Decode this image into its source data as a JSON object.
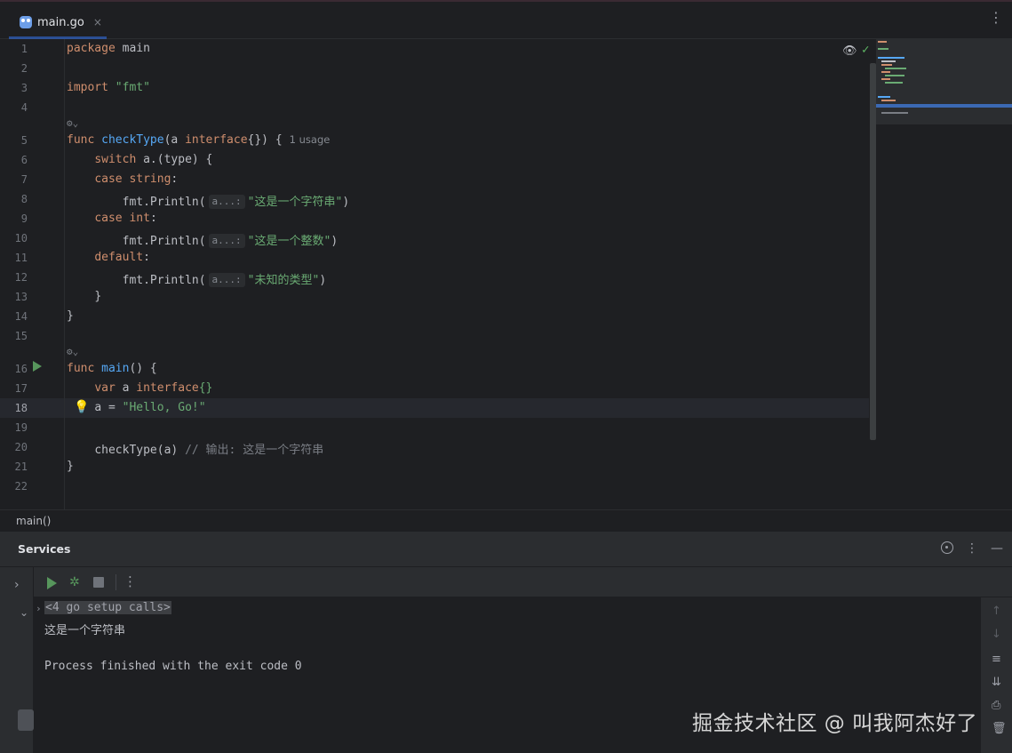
{
  "tab": {
    "filename": "main.go",
    "close": "×",
    "file_icon": "go-gopher-icon"
  },
  "editor_menu": "⋮",
  "lines": [
    {
      "n": "1"
    },
    {
      "n": "2"
    },
    {
      "n": "3"
    },
    {
      "n": "4"
    },
    {
      "n": "5"
    },
    {
      "n": "6"
    },
    {
      "n": "7"
    },
    {
      "n": "8"
    },
    {
      "n": "9"
    },
    {
      "n": "10"
    },
    {
      "n": "11"
    },
    {
      "n": "12"
    },
    {
      "n": "13"
    },
    {
      "n": "14"
    },
    {
      "n": "15"
    },
    {
      "n": "16"
    },
    {
      "n": "17"
    },
    {
      "n": "18"
    },
    {
      "n": "19"
    },
    {
      "n": "20"
    },
    {
      "n": "21"
    },
    {
      "n": "22"
    }
  ],
  "code": {
    "l1_kw": "package",
    "l1_name": " main",
    "l3_kw": "import",
    "l3_str": " \"fmt\"",
    "l5_kw": "func",
    "l5_fn": " checkType",
    "l5_p1": "(a ",
    "l5_iface": "interface",
    "l5_p2": "{}) {",
    "l5_usage": "1 usage",
    "l6_kw": "switch",
    "l6_rest": " a.(type) {",
    "l7_kw": "case",
    "l7_type": " string",
    "l7_colon": ":",
    "l8_call": "fmt.Println(",
    "l8_hint": "a...:",
    "l8_str": "\"这是一个字符串\"",
    "l8_end": ")",
    "l9_kw": "case",
    "l9_type": " int",
    "l9_colon": ":",
    "l10_call": "fmt.Println(",
    "l10_hint": "a...:",
    "l10_str": "\"这是一个整数\"",
    "l10_end": ")",
    "l11_kw": "default",
    "l11_colon": ":",
    "l12_call": "fmt.Println(",
    "l12_hint": "a...:",
    "l12_str": "\"未知的类型\"",
    "l12_end": ")",
    "l13": "}",
    "l14": "}",
    "l16_kw": "func",
    "l16_fn": " main",
    "l16_rest": "() {",
    "l17_kw": "var",
    "l17_name": " a ",
    "l17_iface": "interface",
    "l17_end": "{}",
    "l18_lhs": "a = ",
    "l18_str": "\"Hello, Go!\"",
    "l20_call": "checkType(a) ",
    "l20_cmt": "// 输出: 这是一个字符串",
    "l21": "}"
  },
  "breadcrumb": "main()",
  "services": {
    "title": "Services",
    "console": {
      "setup": "<4 go setup calls>",
      "output": "这是一个字符串",
      "exit": "Process finished with the exit code 0"
    }
  },
  "watermark": "掘金技术社区 @ 叫我阿杰好了",
  "colors": {
    "keyword": "#cf8e6d",
    "function": "#56a8f5",
    "string": "#6aab73",
    "comment": "#7a7e85",
    "background": "#1e1f22",
    "panel": "#2b2d30",
    "run": "#57965c"
  }
}
